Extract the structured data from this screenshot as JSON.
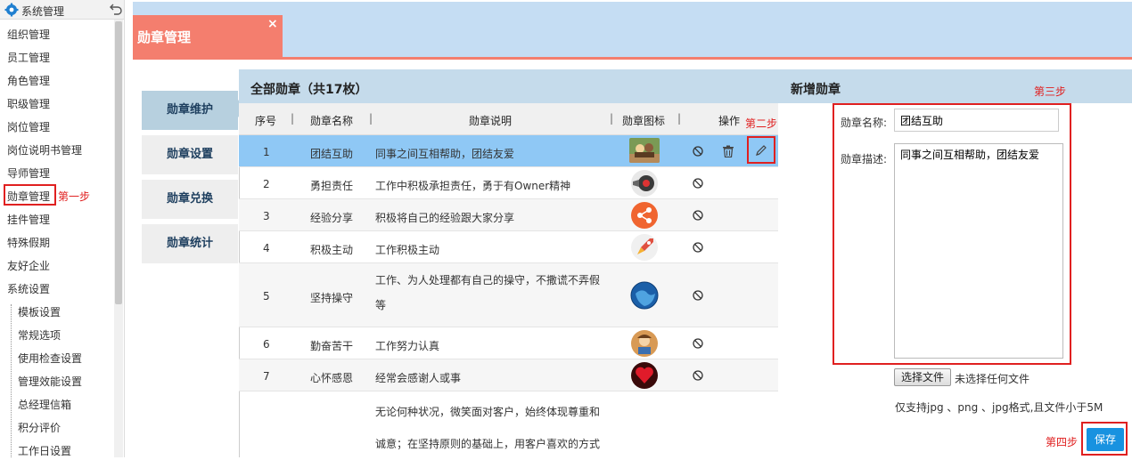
{
  "sidebar": {
    "title": "系统管理",
    "items": [
      {
        "label": "组织管理"
      },
      {
        "label": "员工管理"
      },
      {
        "label": "角色管理"
      },
      {
        "label": "职级管理"
      },
      {
        "label": "岗位管理"
      },
      {
        "label": "岗位说明书管理"
      },
      {
        "label": "导师管理"
      },
      {
        "label": "勋章管理",
        "active": true
      },
      {
        "label": "挂件管理"
      },
      {
        "label": "特殊假期"
      },
      {
        "label": "友好企业"
      },
      {
        "label": "系统设置"
      }
    ],
    "sub_items": [
      {
        "label": "模板设置"
      },
      {
        "label": "常规选项"
      },
      {
        "label": "使用检查设置"
      },
      {
        "label": "管理效能设置"
      },
      {
        "label": "总经理信箱"
      },
      {
        "label": "积分评价"
      },
      {
        "label": "工作日设置"
      }
    ]
  },
  "steps": {
    "step1": "第一步",
    "step2": "第二步",
    "step3": "第三步",
    "step4": "第四步"
  },
  "header": {
    "tab_label": "勋章管理",
    "close_glyph": "×"
  },
  "vtabs": [
    {
      "label": "勋章维护",
      "active": true
    },
    {
      "label": "勋章设置"
    },
    {
      "label": "勋章兑换"
    },
    {
      "label": "勋章统计"
    }
  ],
  "table": {
    "title": "全部勋章（共17枚）",
    "columns": [
      "序号",
      "勋章名称",
      "勋章说明",
      "勋章图标",
      "操作"
    ],
    "rows": [
      {
        "no": "1",
        "name": "团结互助",
        "desc": "同事之间互相帮助，团结友爱",
        "icon": "teamwork-icon",
        "selected": true
      },
      {
        "no": "2",
        "name": "勇担责任",
        "desc": "工作中积极承担责任，勇于有Owner精神",
        "icon": "responsibility-icon"
      },
      {
        "no": "3",
        "name": "经验分享",
        "desc": "积极将自己的经验跟大家分享",
        "icon": "share-icon"
      },
      {
        "no": "4",
        "name": "积极主动",
        "desc": "工作积极主动",
        "icon": "rocket-icon"
      },
      {
        "no": "5",
        "name": "坚持操守",
        "desc": "工作、为人处理都有自己的操守，不撒谎不弄假等",
        "icon": "globe-icon"
      },
      {
        "no": "6",
        "name": "勤奋苦干",
        "desc": "工作努力认真",
        "icon": "worker-icon"
      },
      {
        "no": "7",
        "name": "心怀感恩",
        "desc": "经常会感谢人或事",
        "icon": "heart-icon"
      },
      {
        "no": "",
        "name": "",
        "desc": "无论何种状况，微笑面对客户，始终体现尊重和诚意；在坚持原则的基础上，用客户喜欢的方式",
        "icon": ""
      }
    ]
  },
  "form": {
    "title": "新增勋章",
    "name_label": "勋章名称:",
    "name_value": "团结互助",
    "desc_label": "勋章描述:",
    "desc_value": "同事之间互相帮助，团结友爱",
    "file_button": "选择文件",
    "file_status": "未选择任何文件",
    "file_hint": "仅支持jpg 、png 、jpg格式,且文件小于5M",
    "save_label": "保存"
  },
  "colors": {
    "accent": "#f47e6e",
    "header_bg": "#c5ddf3",
    "selected_row": "#8fc8f5",
    "save_btn": "#1892e0",
    "annotation": "#e02020"
  }
}
